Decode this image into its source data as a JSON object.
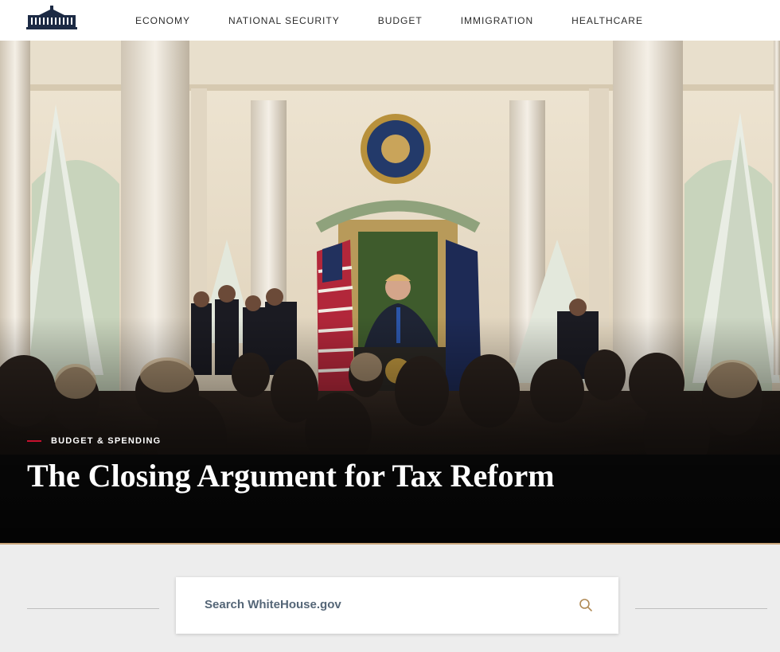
{
  "nav": {
    "logo_icon": "white-house-logo-icon",
    "items": [
      {
        "label": "ECONOMY"
      },
      {
        "label": "NATIONAL SECURITY"
      },
      {
        "label": "BUDGET"
      },
      {
        "label": "IMMIGRATION"
      },
      {
        "label": "HEALTHCARE"
      }
    ]
  },
  "hero": {
    "category": "BUDGET & SPENDING",
    "title": "The Closing Argument for Tax Reform",
    "accent_color": "#c8102e"
  },
  "search": {
    "placeholder": "Search WhiteHouse.gov",
    "icon": "search-icon"
  }
}
